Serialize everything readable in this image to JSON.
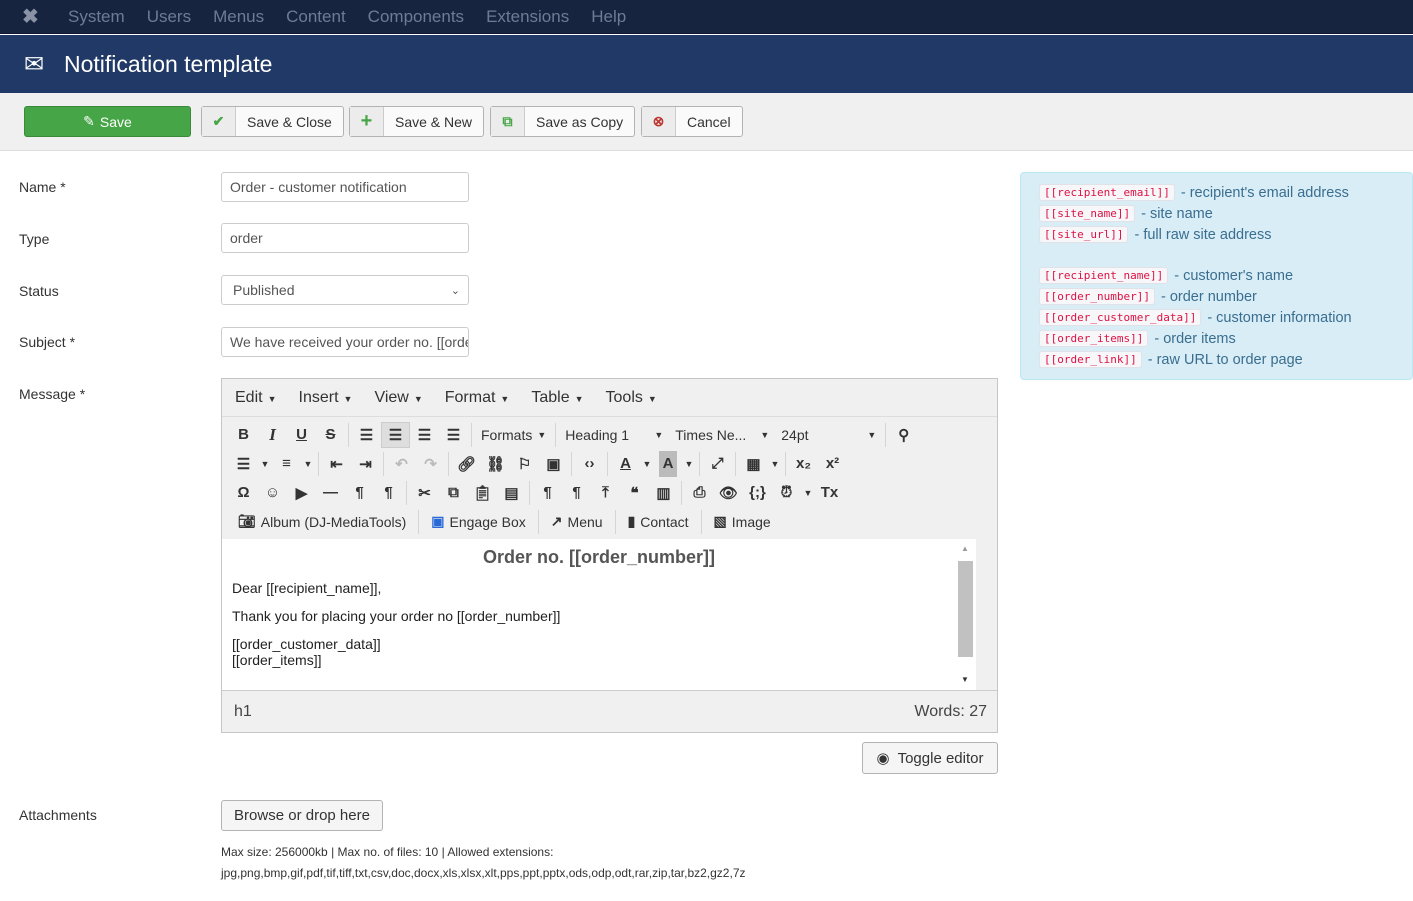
{
  "nav": {
    "items": [
      "System",
      "Users",
      "Menus",
      "Content",
      "Components",
      "Extensions",
      "Help"
    ]
  },
  "header": {
    "title": "Notification template"
  },
  "toolbar": {
    "save": "Save",
    "save_close": "Save & Close",
    "save_new": "Save & New",
    "save_copy": "Save as Copy",
    "cancel": "Cancel"
  },
  "form": {
    "name_label": "Name *",
    "name_value": "Order - customer notification",
    "type_label": "Type",
    "type_value": "order",
    "status_label": "Status",
    "status_value": "Published",
    "subject_label": "Subject *",
    "subject_value": "We have received your order no. [[order_number]]",
    "message_label": "Message *",
    "attachments_label": "Attachments"
  },
  "editor": {
    "menus": [
      "Edit",
      "Insert",
      "View",
      "Format",
      "Table",
      "Tools"
    ],
    "formats": "Formats",
    "block": "Heading 1",
    "font": "Times Ne...",
    "size": "24pt",
    "plugins": [
      {
        "icon": "camera-icon",
        "label": "Album (DJ-MediaTools)"
      },
      {
        "icon": "engage-box-icon",
        "label": "Engage Box"
      },
      {
        "icon": "share-icon",
        "label": "Menu"
      },
      {
        "icon": "contact-icon",
        "label": "Contact"
      },
      {
        "icon": "image-icon",
        "label": "Image"
      }
    ],
    "row2": [
      "bullet-list-icon",
      "caret",
      "numbered-list-icon",
      "caret",
      "|",
      "outdent-icon",
      "indent-icon",
      "|",
      "undo-icon",
      "redo-icon",
      "|",
      "link-icon",
      "unlink-icon",
      "bookmark-icon",
      "insert-image-icon",
      "|",
      "code-icon",
      "|",
      "text-color-icon",
      "caret",
      "background-color-icon",
      "caret",
      "|",
      "fullscreen-icon",
      "|",
      "table-icon",
      "caret",
      "|",
      "subscript-icon",
      "superscript-icon"
    ],
    "row3": [
      "special-char-icon",
      "emoticon-icon",
      "media-icon",
      "horizontal-rule-icon",
      "ltr-icon",
      "rtl-icon",
      "|",
      "cut-icon",
      "copy-icon",
      "paste-icon",
      "paste-text-icon",
      "|",
      "show-blocks-icon",
      "pilcrow-icon",
      "upload-icon",
      "blockquote-icon",
      "template-icon",
      "|",
      "print-icon",
      "preview-icon",
      "code-sample-icon",
      "clock-icon",
      "caret",
      "remove-format-icon"
    ],
    "content": {
      "heading": "Order no. [[order_number]]",
      "p1": "Dear [[recipient_name]],",
      "p2": "Thank you for placing your order no [[order_number]]",
      "p3a": "[[order_customer_data]]",
      "p3b": "[[order_items]]"
    },
    "path": "h1",
    "words": "Words: 27",
    "toggle": "Toggle editor"
  },
  "attachments": {
    "browse": "Browse or drop here",
    "info1": "Max size: 256000kb | Max no. of files: 10 | Allowed extensions:",
    "info2": "jpg,png,bmp,gif,pdf,tif,tiff,txt,csv,doc,docx,xls,xlsx,xlt,pps,ppt,pptx,ods,odp,odt,rar,zip,tar,bz2,gz2,7z"
  },
  "help": {
    "group1": [
      {
        "tag": "[[recipient_email]]",
        "desc": "- recipient's email address"
      },
      {
        "tag": "[[site_name]]",
        "desc": "- site name"
      },
      {
        "tag": "[[site_url]]",
        "desc": "- full raw site address"
      }
    ],
    "group2": [
      {
        "tag": "[[recipient_name]]",
        "desc": "- customer's name"
      },
      {
        "tag": "[[order_number]]",
        "desc": "- order number"
      },
      {
        "tag": "[[order_customer_data]]",
        "desc": "- customer information"
      },
      {
        "tag": "[[order_items]]",
        "desc": "- order items"
      },
      {
        "tag": "[[order_link]]",
        "desc": "- raw URL to order page"
      }
    ]
  },
  "colors": {
    "nav_bg": "#172440",
    "header_bg": "#213966",
    "save_green": "#46a546",
    "tag_red": "#dd1144",
    "help_bg": "#d9edf7"
  }
}
